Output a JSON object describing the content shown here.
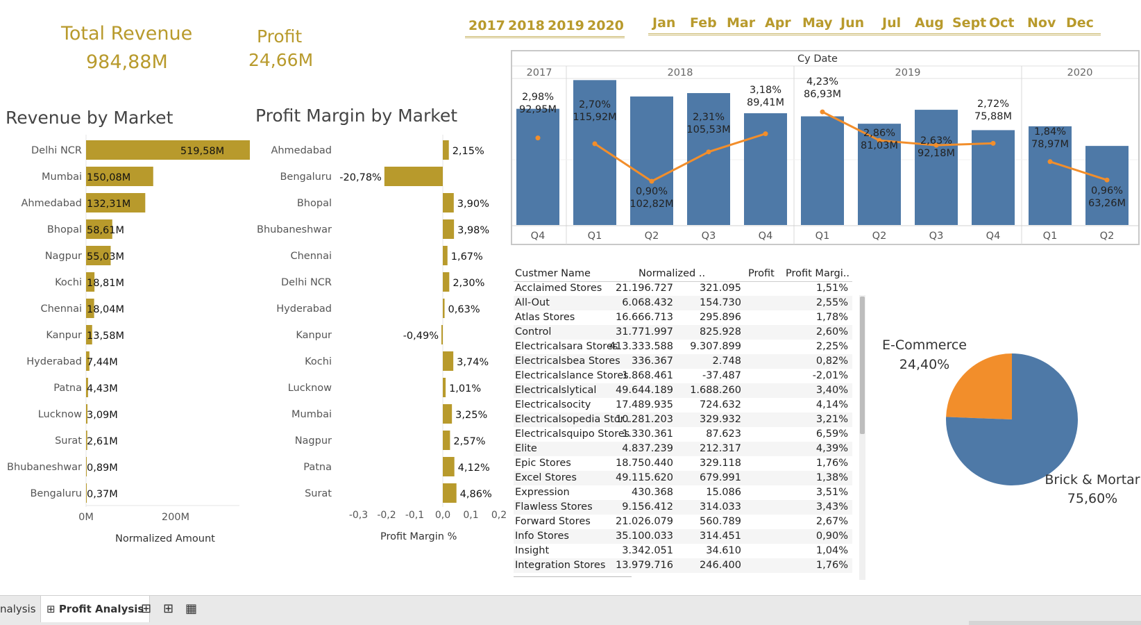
{
  "kpis": {
    "revenue_label": "Total Revenue",
    "revenue_value": "984,88M",
    "profit_label": "Profit",
    "profit_value": "24,66M"
  },
  "filters": {
    "years": [
      "2017",
      "2018",
      "2019",
      "2020"
    ],
    "months": [
      "Jan",
      "Feb",
      "Mar",
      "Apr",
      "May",
      "Jun",
      "Jul",
      "Aug",
      "Sept",
      "Oct",
      "Nov",
      "Dec"
    ]
  },
  "revenue_chart": {
    "title": "Revenue by Market",
    "xlabel": "Normalized Amount"
  },
  "margin_chart": {
    "title": "Profit Margin by Market",
    "xlabel": "Profit Margin %"
  },
  "trend_chart": {
    "header": "Cy Date"
  },
  "table": {
    "headers": [
      "Custmer Name",
      "Normalized ..",
      "Profit",
      "Profit Margi.."
    ],
    "rows": [
      [
        "Acclaimed Stores",
        "21.196.727",
        "321.095",
        "1,51%"
      ],
      [
        "All-Out",
        "6.068.432",
        "154.730",
        "2,55%"
      ],
      [
        "Atlas Stores",
        "16.666.713",
        "295.896",
        "1,78%"
      ],
      [
        "Control",
        "31.771.997",
        "825.928",
        "2,60%"
      ],
      [
        "Electricalsara Stores",
        "413.333.588",
        "9.307.899",
        "2,25%"
      ],
      [
        "Electricalsbea Stores",
        "336.367",
        "2.748",
        "0,82%"
      ],
      [
        "Electricalslance Stores",
        "1.868.461",
        "-37.487",
        "-2,01%"
      ],
      [
        "Electricalslytical",
        "49.644.189",
        "1.688.260",
        "3,40%"
      ],
      [
        "Electricalsocity",
        "17.489.935",
        "724.632",
        "4,14%"
      ],
      [
        "Electricalsopedia Stor..",
        "10.281.203",
        "329.932",
        "3,21%"
      ],
      [
        "Electricalsquipo Stores",
        "1.330.361",
        "87.623",
        "6,59%"
      ],
      [
        "Elite",
        "4.837.239",
        "212.317",
        "4,39%"
      ],
      [
        "Epic Stores",
        "18.750.440",
        "329.118",
        "1,76%"
      ],
      [
        "Excel Stores",
        "49.115.620",
        "679.991",
        "1,38%"
      ],
      [
        "Expression",
        "430.368",
        "15.086",
        "3,51%"
      ],
      [
        "Flawless Stores",
        "9.156.412",
        "314.033",
        "3,43%"
      ],
      [
        "Forward Stores",
        "21.026.079",
        "560.789",
        "2,67%"
      ],
      [
        "Info Stores",
        "35.100.033",
        "314.451",
        "0,90%"
      ],
      [
        "Insight",
        "3.342.051",
        "34.610",
        "1,04%"
      ],
      [
        "Integration Stores",
        "13.979.716",
        "246.400",
        "1,76%"
      ]
    ]
  },
  "pie": {
    "slices": [
      {
        "name": "E-Commerce",
        "pct_label": "24,40%",
        "value": 24.4,
        "color": "#f28e2b"
      },
      {
        "name": "Brick & Mortar",
        "pct_label": "75,60%",
        "value": 75.6,
        "color": "#4e79a7"
      }
    ]
  },
  "tabs": {
    "prev_tab": "nalysis",
    "active_tab": "Profit Analysis"
  },
  "colors": {
    "gold": "#b89a2c",
    "blue": "#4e79a7",
    "orange": "#f28e2b"
  },
  "chart_data": [
    {
      "type": "bar",
      "title": "Revenue by Market",
      "xlabel": "Normalized Amount",
      "orientation": "horizontal",
      "categories": [
        "Delhi NCR",
        "Mumbai",
        "Ahmedabad",
        "Bhopal",
        "Nagpur",
        "Kochi",
        "Chennai",
        "Kanpur",
        "Hyderabad",
        "Patna",
        "Lucknow",
        "Surat",
        "Bhubaneshwar",
        "Bengaluru"
      ],
      "values": [
        519.58,
        150.08,
        132.31,
        58.61,
        55.03,
        18.81,
        18.04,
        13.58,
        7.44,
        4.43,
        3.09,
        2.61,
        0.89,
        0.37
      ],
      "labels": [
        "519,58M",
        "150,08M",
        "132,31M",
        "58,61M",
        "55,03M",
        "18,81M",
        "18,04M",
        "13,58M",
        "7,44M",
        "4,43M",
        "3,09M",
        "2,61M",
        "0,89M",
        "0,37M"
      ],
      "xticks": [
        "0M",
        "200M",
        "400M"
      ],
      "xlim": [
        0,
        520
      ]
    },
    {
      "type": "bar",
      "title": "Profit Margin by Market",
      "xlabel": "Profit Margin %",
      "orientation": "horizontal",
      "categories": [
        "Ahmedabad",
        "Bengaluru",
        "Bhopal",
        "Bhubaneshwar",
        "Chennai",
        "Delhi NCR",
        "Hyderabad",
        "Kanpur",
        "Kochi",
        "Lucknow",
        "Mumbai",
        "Nagpur",
        "Patna",
        "Surat"
      ],
      "values": [
        0.0215,
        -0.2078,
        0.039,
        0.0398,
        0.0167,
        0.023,
        0.0063,
        -0.0049,
        0.0374,
        0.0101,
        0.0325,
        0.0257,
        0.0412,
        0.0486
      ],
      "labels": [
        "2,15%",
        "-20,78%",
        "3,90%",
        "3,98%",
        "1,67%",
        "2,30%",
        "0,63%",
        "-0,49%",
        "3,74%",
        "1,01%",
        "3,25%",
        "2,57%",
        "4,12%",
        "4,86%"
      ],
      "xticks": [
        "-0,3",
        "-0,2",
        "-0,1",
        "0,0",
        "0,1",
        "0,2"
      ],
      "xlim": [
        -0.3,
        0.2
      ]
    },
    {
      "type": "bar",
      "title": "",
      "header": "Cy Date",
      "years": [
        {
          "label": "2017",
          "quarters": 1
        },
        {
          "label": "2018",
          "quarters": 4
        },
        {
          "label": "2019",
          "quarters": 4
        },
        {
          "label": "2020",
          "quarters": 2
        }
      ],
      "categories": [
        "Q4",
        "Q1",
        "Q2",
        "Q3",
        "Q4",
        "Q1",
        "Q2",
        "Q3",
        "Q4",
        "Q1",
        "Q2"
      ],
      "series": [
        {
          "type": "bar",
          "values": [
            92.95,
            115.92,
            102.82,
            105.53,
            89.41,
            86.93,
            81.03,
            92.18,
            75.88,
            78.97,
            63.26
          ],
          "labels": [
            "92,95M",
            "115,92M",
            "102,82M",
            "105,53M",
            "89,41M",
            "86,93M",
            "81,03M",
            "92,18M",
            "75,88M",
            "78,97M",
            "63,26M"
          ]
        },
        {
          "type": "line",
          "values": [
            2.98,
            2.7,
            0.9,
            2.31,
            3.18,
            4.23,
            2.86,
            2.63,
            2.72,
            1.84,
            0.96
          ],
          "labels": [
            "2,98%",
            "2,70%",
            "0,90%",
            "2,31%",
            "3,18%",
            "4,23%",
            "2,86%",
            "2,63%",
            "2,72%",
            "1,84%",
            "0,96%"
          ],
          "segments": [
            [
              0
            ],
            [
              1,
              2,
              3,
              4
            ],
            [
              5,
              6,
              7,
              8
            ],
            [
              9,
              10
            ]
          ]
        }
      ]
    },
    {
      "type": "pie",
      "categories": [
        "E-Commerce",
        "Brick & Mortar"
      ],
      "values": [
        24.4,
        75.6
      ],
      "labels": [
        "24,40%",
        "75,60%"
      ]
    }
  ]
}
